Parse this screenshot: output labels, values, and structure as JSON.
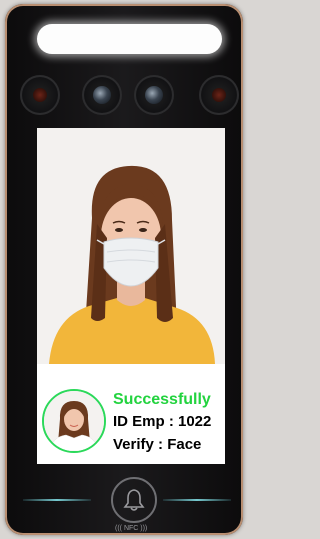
{
  "verification": {
    "status": "Successfully",
    "id_line": "ID Emp : 1022",
    "verify_line": "Verify : Face",
    "status_color": "#23d33f"
  },
  "device": {
    "nfc_label": "((( NFC )))",
    "bell_icon": "bell-icon"
  }
}
